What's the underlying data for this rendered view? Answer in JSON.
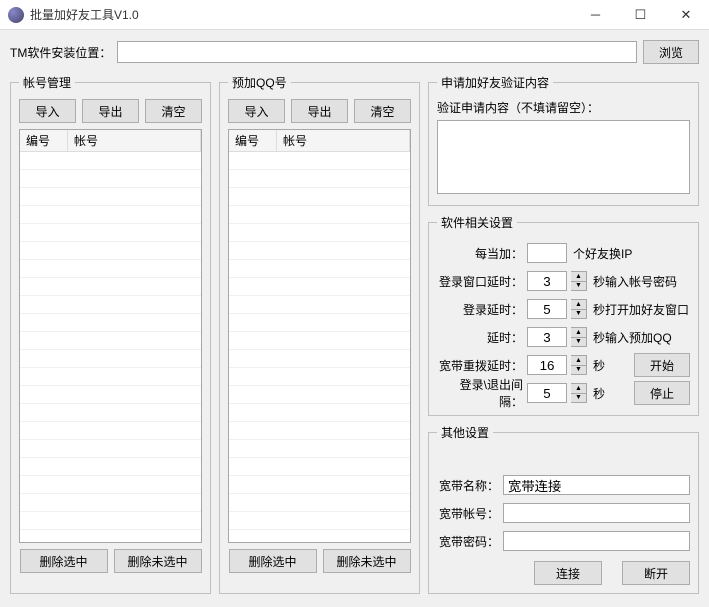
{
  "window": {
    "title": "批量加好友工具V1.0"
  },
  "path": {
    "label": "TM软件安装位置：",
    "value": "",
    "browse": "浏览"
  },
  "accounts": {
    "legend": "帐号管理",
    "import": "导入",
    "export": "导出",
    "clear": "清空",
    "col1": "编号",
    "col2": "帐号",
    "del_selected": "删除选中",
    "del_unselected": "删除未选中"
  },
  "preadd": {
    "legend": "预加QQ号",
    "import": "导入",
    "export": "导出",
    "clear": "清空",
    "col1": "编号",
    "col2": "帐号",
    "del_selected": "删除选中",
    "del_unselected": "删除未选中"
  },
  "verify": {
    "legend": "申请加好友验证内容",
    "label": "验证申请内容（不填请留空）：",
    "value": ""
  },
  "settings": {
    "legend": "软件相关设置",
    "row1_lbl": "每当加：",
    "row1_val": "",
    "row1_after": "个好友换IP",
    "row2_lbl": "登录窗口延时：",
    "row2_val": "3",
    "row2_after": "秒输入帐号密码",
    "row3_lbl": "登录延时：",
    "row3_val": "5",
    "row3_after": "秒打开加好友窗口",
    "row4_lbl": "延时：",
    "row4_val": "3",
    "row4_after": "秒输入预加QQ",
    "row5_lbl": "宽带重拨延时：",
    "row5_val": "16",
    "row5_after": "秒",
    "start": "开始",
    "row6_lbl": "登录\\退出间隔：",
    "row6_val": "5",
    "row6_after": "秒",
    "stop": "停止"
  },
  "other": {
    "legend": "其他设置",
    "name_lbl": "宽带名称：",
    "name_val": "宽带连接",
    "acct_lbl": "宽带帐号：",
    "acct_val": "",
    "pwd_lbl": "宽带密码：",
    "pwd_val": "",
    "connect": "连接",
    "disconnect": "断开"
  }
}
